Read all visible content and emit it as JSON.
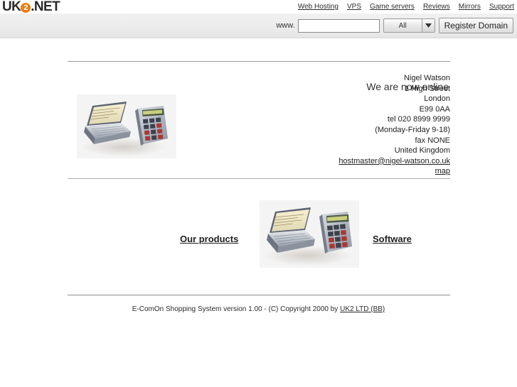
{
  "header": {
    "logo": {
      "prefix": "UK",
      "circle": "2",
      "suffix": ".NET"
    },
    "nav": [
      {
        "label": "Web Hosting"
      },
      {
        "label": "VPS"
      },
      {
        "label": "Game servers"
      },
      {
        "label": "Reviews"
      },
      {
        "label": "Mirrors"
      },
      {
        "label": "Support"
      }
    ],
    "search": {
      "www_label": "www.",
      "domain_value": "",
      "domain_placeholder": "",
      "tld_selected": "All",
      "tld_options": [
        "All"
      ],
      "register_label": "Register Domain"
    }
  },
  "main": {
    "heading": "We are now online",
    "address": {
      "name": "Nigel Watson",
      "street": "1 High Street",
      "city": "London",
      "postcode": "E99 0AA",
      "tel": "tel 020 8999 9999",
      "hours": "(Monday-Friday 9-18)",
      "fax": "fax NONE",
      "country": "United Kingdom",
      "email": "hostmaster@nigel-watson.co.uk",
      "map_label": "map"
    },
    "links": {
      "our_products": "Our products",
      "software": "Software"
    },
    "illustration_alt": "chequebook-and-calculator-illustration"
  },
  "footer": {
    "text_before": "E-ComOn Shopping System version 1.00 - (C) Copyright 2000 by ",
    "company_link": "UK2 LTD  (BB)"
  },
  "colors": {
    "brand_orange": "#f07d0a",
    "page_background": "#ffffff",
    "band_background": "#ececec",
    "rule": "#9d9d9d",
    "text": "#222222"
  }
}
